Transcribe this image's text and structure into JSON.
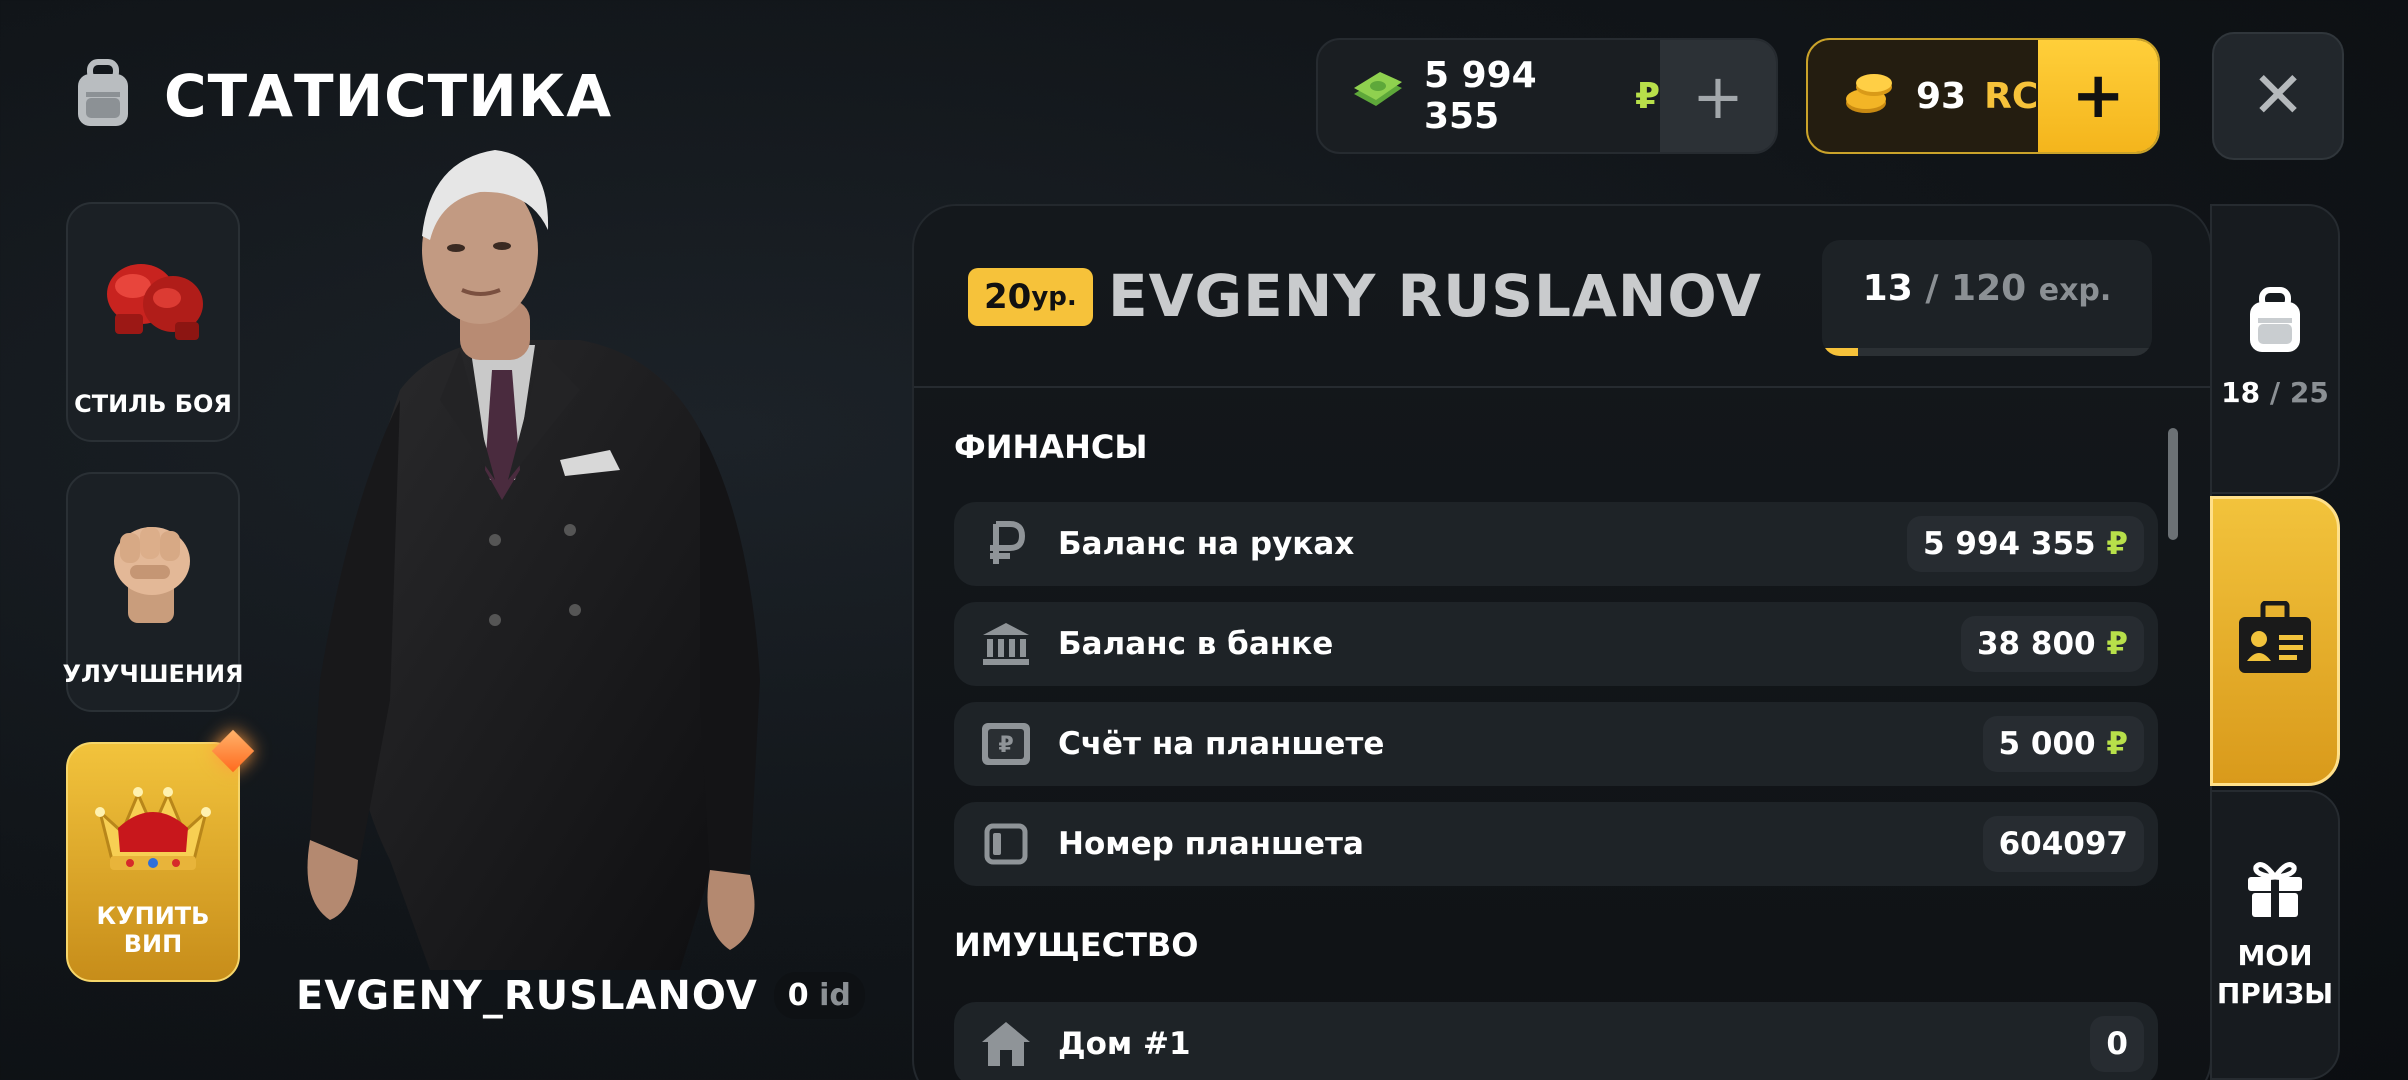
{
  "header": {
    "title": "СТАТИСТИКА",
    "title_icon": "backpack-icon",
    "money": {
      "amount": "5 994 355",
      "currency": "₽",
      "add_label": "+"
    },
    "rc": {
      "amount": "93",
      "currency": "RC",
      "add_label": "+"
    },
    "close_label": "✕"
  },
  "side_menu": [
    {
      "label": "СТИЛЬ БОЯ",
      "icon": "boxing-gloves-icon"
    },
    {
      "label": "УЛУЧШЕНИЯ",
      "icon": "fist-icon"
    },
    {
      "label": "КУПИТЬ ВИП",
      "icon": "crown-icon"
    }
  ],
  "player": {
    "name": "EVGENY_RUSLANOV",
    "id_value": "0",
    "id_label": "id"
  },
  "profile": {
    "level_num": "20",
    "level_suffix": "ур.",
    "display_name": "EVGENY RUSLANOV",
    "exp_current": "13",
    "exp_sep": "/",
    "exp_max": "120",
    "exp_unit": "exp.",
    "exp_progress": 0.108
  },
  "finances": {
    "title": "ФИНАНСЫ",
    "rows": [
      {
        "label": "Баланс на руках",
        "value": "5 994 355",
        "currency": "₽",
        "icon": "ruble-icon"
      },
      {
        "label": "Баланс в банке",
        "value": "38 800",
        "currency": "₽",
        "icon": "bank-icon"
      },
      {
        "label": "Счёт на планшете",
        "value": "5 000",
        "currency": "₽",
        "icon": "tablet-wallet-icon"
      },
      {
        "label": "Номер планшета",
        "value": "604097",
        "currency": "",
        "icon": "tablet-icon"
      }
    ]
  },
  "property": {
    "title": "ИМУЩЕСТВО",
    "rows": [
      {
        "label": "Дом #1",
        "value": "0",
        "icon": "house-icon"
      }
    ]
  },
  "tabs": {
    "inventory": {
      "count": "18",
      "sep": "/",
      "max": "25",
      "icon": "backpack-icon"
    },
    "stats": {
      "icon": "id-card-icon"
    },
    "prizes": {
      "label_line1": "МОИ",
      "label_line2": "ПРИЗЫ",
      "icon": "gift-icon"
    }
  },
  "colors": {
    "accent_gold": "#f6c23a",
    "ruble_green": "#b8e04a",
    "panel_bg": "#14181c",
    "row_bg": "#1e2327"
  }
}
